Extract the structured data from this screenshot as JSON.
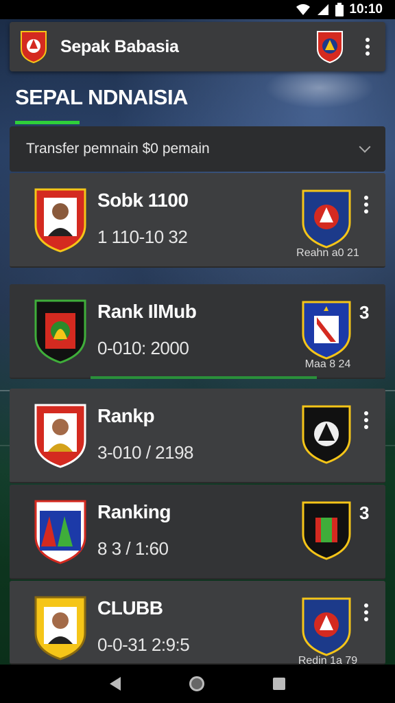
{
  "status_bar": {
    "time": "10:10"
  },
  "app_bar": {
    "title": "Sepak Babasia"
  },
  "section": {
    "title": "SEPAL NDNAISIA"
  },
  "filter": {
    "label": "Transfer pemnain $0 pemain"
  },
  "rows": [
    {
      "name": "Sobk 1100",
      "score": "1 110-10 32",
      "right_caption": "Reahn a0 21",
      "right_action": "menu"
    },
    {
      "name": "Rank IlMub",
      "score": "0-010: 2000",
      "right_caption": "Maa 8 24",
      "right_action": "3"
    },
    {
      "name": "Rankp",
      "score": "3-010 / 2198",
      "right_caption": "",
      "right_action": "menu"
    },
    {
      "name": "Ranking",
      "score": "8 3 / 1:60",
      "right_caption": "",
      "right_action": "3"
    },
    {
      "name": "CLUBB",
      "score": "0-0-31 2:9:5",
      "right_caption": "Redin 1a 79",
      "right_action": "menu"
    }
  ],
  "icons": {
    "app_logo": "club-crest-icon",
    "app_right": "club-crest-icon",
    "menu": "more-vert-icon",
    "filter_chevron": "chevron-down-icon",
    "nav": [
      "back-icon",
      "home-icon",
      "recents-icon"
    ]
  },
  "colors": {
    "accent": "#2fcf3a",
    "bar": "#3a3b3d",
    "row": "#3d3e40"
  }
}
